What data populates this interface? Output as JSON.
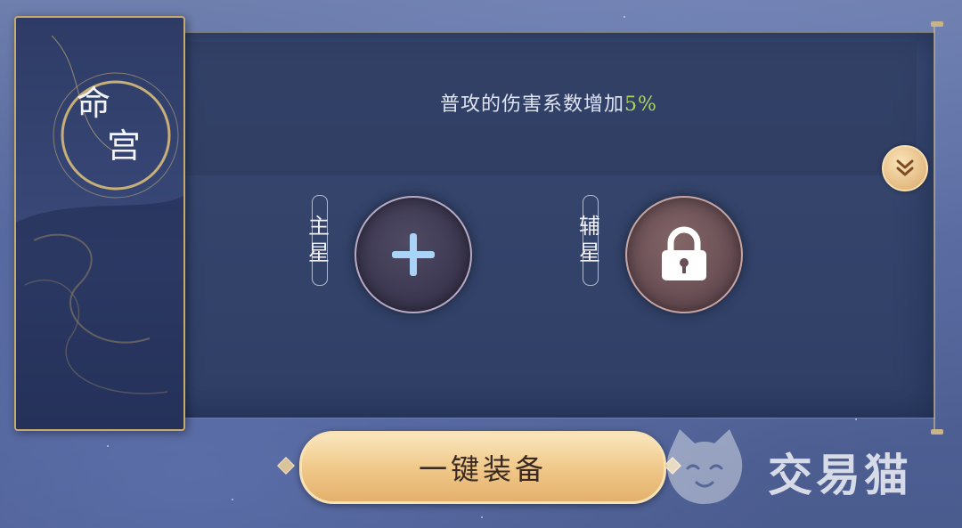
{
  "banner": {
    "title_line1": "命",
    "title_line2": "宫"
  },
  "description": {
    "text": "普攻的伤害系数增加",
    "value": "5%",
    "value_color": "#a9d65a"
  },
  "slots": {
    "main": {
      "label_char1": "主",
      "label_char2": "星",
      "icon": "plus-icon"
    },
    "sub": {
      "label_char1": "辅",
      "label_char2": "星",
      "icon": "lock-icon"
    }
  },
  "buttons": {
    "equip_label": "一键装备",
    "expand_icon": "double-chevron-down-icon"
  },
  "watermark": {
    "text": "交易猫",
    "logo_icon": "cat-logo-icon"
  },
  "colors": {
    "gold": "#c6a96c",
    "panel": "#34446b",
    "button": "#f0c98a"
  }
}
